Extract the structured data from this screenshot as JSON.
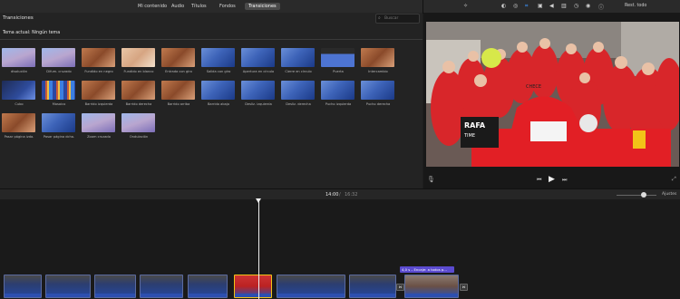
{
  "tabs": [
    {
      "label": "Mi contenido",
      "active": false
    },
    {
      "label": "Audio",
      "active": false
    },
    {
      "label": "Títulos",
      "active": false
    },
    {
      "label": "Fondos",
      "active": false
    },
    {
      "label": "Transiciones",
      "active": true
    }
  ],
  "browser": {
    "title": "Transiciones",
    "search_placeholder": "Buscar",
    "current_theme": "Tema actual: Ningún tema"
  },
  "transitions": [
    {
      "label": "disolución",
      "style": "b2"
    },
    {
      "label": "Difum. cruzado",
      "style": "b2"
    },
    {
      "label": "Fundido en negro",
      "style": "b3"
    },
    {
      "label": "Fundido en blanco",
      "style": "b4"
    },
    {
      "label": "Entrada con giro",
      "style": "b3"
    },
    {
      "label": "Salida con giro",
      "style": "b1"
    },
    {
      "label": "Apertura en círculo",
      "style": "b1"
    },
    {
      "label": "Cierre en círculo",
      "style": "b1"
    },
    {
      "label": "Puerta",
      "style": "b7"
    },
    {
      "label": "Intercambio",
      "style": "b3"
    },
    {
      "label": "Cubo",
      "style": "b5"
    },
    {
      "label": "Mosaico",
      "style": "b6"
    },
    {
      "label": "Barrido izquierda",
      "style": "b3"
    },
    {
      "label": "Barrido derecha",
      "style": "b3"
    },
    {
      "label": "Barrido arriba",
      "style": "b3"
    },
    {
      "label": "Barrido abajo",
      "style": "b1"
    },
    {
      "label": "Desliz. izquierda",
      "style": "b1"
    },
    {
      "label": "Desliz. derecha",
      "style": "b1"
    },
    {
      "label": "Pucho izquierda",
      "style": "b1"
    },
    {
      "label": "Pucho derecha",
      "style": "b1"
    },
    {
      "label": "Pasar página izda.",
      "style": "b3"
    },
    {
      "label": "Pasar página dcha.",
      "style": "b1"
    },
    {
      "label": "Zoom cruzado",
      "style": "b2"
    },
    {
      "label": "Ondulación",
      "style": "b2"
    }
  ],
  "viewer": {
    "reset_label": "Rest. todo",
    "banner_text": "RAFA",
    "banner_text2": "TIME",
    "car_text": "CHECE"
  },
  "timeline": {
    "current_time": "14:00",
    "separator": "/",
    "total_time": "16:32",
    "settings_label": "Ajustes",
    "title_clip_label": "4,0 s – Encaje: a todos p..."
  },
  "colors": {
    "accent_selection": "#f2c318",
    "title_clip": "#5b4bd0"
  }
}
